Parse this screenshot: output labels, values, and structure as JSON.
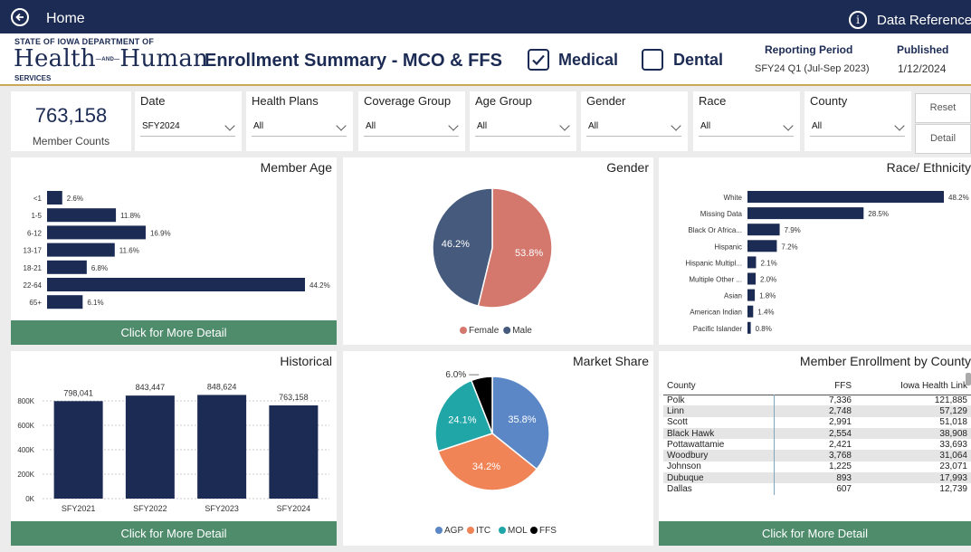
{
  "nav": {
    "home_label": "Home",
    "data_reference_label": "Data Reference"
  },
  "header": {
    "logo_top": "STATE OF IOWA DEPARTMENT OF",
    "logo_word_1": "Health",
    "logo_and": "AND",
    "logo_word_2": "Human",
    "logo_bottom": "SERVICES",
    "title": "Enrollment Summary - MCO & FFS",
    "medical_label": "Medical",
    "medical_checked": true,
    "dental_label": "Dental",
    "dental_checked": false,
    "reporting_period_label": "Reporting Period",
    "reporting_period_value": "SFY24 Q1 (Jul-Sep 2023)",
    "published_label": "Published",
    "published_value": "1/12/2024"
  },
  "summary": {
    "member_count": "763,158",
    "member_count_label": "Member Counts"
  },
  "filters": [
    {
      "label": "Date",
      "value": "SFY2024"
    },
    {
      "label": "Health Plans",
      "value": "All"
    },
    {
      "label": "Coverage Group",
      "value": "All"
    },
    {
      "label": "Age Group",
      "value": "All"
    },
    {
      "label": "Gender",
      "value": "All"
    },
    {
      "label": "Race",
      "value": "All"
    },
    {
      "label": "County",
      "value": "All"
    }
  ],
  "buttons": {
    "reset": "Reset",
    "detail": "Detail",
    "more_detail": "Click for More Detail"
  },
  "colors": {
    "navy": "#1c2b54",
    "green": "#4e8c6c",
    "female": "#d4776d",
    "male": "#455a7c",
    "agp": "#5b87c7",
    "itc": "#f08457",
    "mol": "#21a6a8",
    "ffs": "#000000"
  },
  "chart_data": [
    {
      "id": "member_age",
      "type": "bar",
      "orientation": "horizontal",
      "title": "Member Age",
      "categories": [
        "<1",
        "1-5",
        "6-12",
        "13-17",
        "18-21",
        "22-64",
        "65+"
      ],
      "values": [
        2.6,
        11.8,
        16.9,
        11.6,
        6.8,
        44.2,
        6.1
      ],
      "labels": [
        "2.6%",
        "11.8%",
        "16.9%",
        "11.6%",
        "6.8%",
        "44.2%",
        "6.1%"
      ]
    },
    {
      "id": "gender",
      "type": "pie",
      "title": "Gender",
      "categories": [
        "Female",
        "Male"
      ],
      "values": [
        53.8,
        46.2
      ],
      "labels": [
        "53.8%",
        "46.2%"
      ],
      "legend": "bottom"
    },
    {
      "id": "race",
      "type": "bar",
      "orientation": "horizontal",
      "title": "Race/ Ethnicity",
      "categories": [
        "White",
        "Missing Data",
        "Black Or Africa...",
        "Hispanic",
        "Hispanic Multipl...",
        "Multiple Other ...",
        "Asian",
        "American Indian",
        "Pacific Islander"
      ],
      "values": [
        48.2,
        28.5,
        7.9,
        7.2,
        2.1,
        2.0,
        1.8,
        1.4,
        0.8
      ],
      "labels": [
        "48.2%",
        "28.5%",
        "7.9%",
        "7.2%",
        "2.1%",
        "2.0%",
        "1.8%",
        "1.4%",
        "0.8%"
      ]
    },
    {
      "id": "historical",
      "type": "bar",
      "title": "Historical",
      "categories": [
        "SFY2021",
        "SFY2022",
        "SFY2023",
        "SFY2024"
      ],
      "values": [
        798041,
        843447,
        848624,
        763158
      ],
      "labels": [
        "798,041",
        "843,447",
        "848,624",
        "763,158"
      ],
      "ylim": [
        0,
        1000000
      ],
      "yticks": [
        0,
        200000,
        400000,
        600000,
        800000
      ],
      "ytick_labels": [
        "0K",
        "200K",
        "400K",
        "600K",
        "800K"
      ],
      "grid": true
    },
    {
      "id": "market_share",
      "type": "pie",
      "title": "Market Share",
      "categories": [
        "AGP",
        "ITC",
        "MOL",
        "FFS"
      ],
      "values": [
        35.8,
        34.2,
        24.1,
        6.0
      ],
      "labels": [
        "35.8%",
        "34.2%",
        "24.1%",
        "6.0%"
      ],
      "legend": "bottom"
    },
    {
      "id": "county_enrollment",
      "type": "table",
      "title": "Member Enrollment by County",
      "columns": [
        "County",
        "FFS",
        "Iowa Health Link"
      ],
      "rows": [
        [
          "Polk",
          "7,336",
          "121,885"
        ],
        [
          "Linn",
          "2,748",
          "57,129"
        ],
        [
          "Scott",
          "2,991",
          "51,018"
        ],
        [
          "Black Hawk",
          "2,554",
          "38,908"
        ],
        [
          "Pottawattamie",
          "2,421",
          "33,693"
        ],
        [
          "Woodbury",
          "3,768",
          "31,064"
        ],
        [
          "Johnson",
          "1,225",
          "23,071"
        ],
        [
          "Dubuque",
          "893",
          "17,993"
        ],
        [
          "Dallas",
          "607",
          "12,739"
        ]
      ]
    }
  ]
}
